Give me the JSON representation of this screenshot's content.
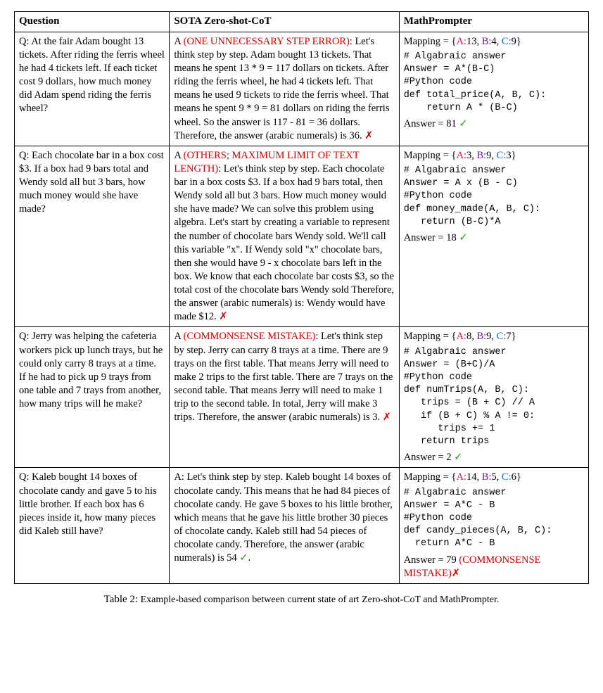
{
  "headers": {
    "q": "Question",
    "sota": "SOTA Zero-shot-CoT",
    "mp": "MathPrompter"
  },
  "caption": {
    "label": "Table 2:",
    "text": "Example-based comparison between current state of art Zero-shot-CoT and MathPrompter."
  },
  "rows": [
    {
      "question": "Q: At the fair Adam bought 13 tickets. After riding the ferris wheel he had 4 tickets left. If each ticket cost 9 dollars, how much money did Adam spend riding the ferris wheel?",
      "sota_prefix": "A ",
      "sota_err": "(ONE UNNECESSARY STEP ERROR)",
      "sota_body": ": Let's think step by step. Adam bought 13 tickets. That means he spent 13 * 9 = 117 dollars on tickets. After riding the ferris wheel, he had 4 tickets left. That means he used 9 tickets to ride the ferris wheel. That means he spent 9 * 9 = 81 dollars on riding the ferris wheel. So the answer is 117 - 81 = 36 dollars. Therefore, the answer (arabic numerals) is 36. ",
      "sota_mark": "✗",
      "sota_mark_color": "err",
      "mapping": {
        "label": "Mapping = {",
        "a": "A:13",
        "b": "B:4",
        "c": "C:9",
        "close": "}"
      },
      "code": "# Algabraic answer\nAnswer = A*(B-C)\n#Python code\ndef total_price(A, B, C):\n    return A * (B-C)",
      "ans_label": "Answer = ",
      "ans_value": "81 ",
      "ans_mark": "✓",
      "ans_mark_color": "ok",
      "ans_err": ""
    },
    {
      "question": "Q: Each chocolate bar in a box cost $3. If a box had 9 bars total and Wendy sold all but 3 bars, how much money would she have made?",
      "sota_prefix": "A ",
      "sota_err": "(OTHERS; MAXIMUM LIMIT OF TEXT LENGTH)",
      "sota_body": ": Let's think step by step. Each chocolate bar in a box costs $3. If a box had 9 bars total, then Wendy sold all but 3 bars. How much money would she have made? We can solve this problem using algebra. Let's start by creating a variable to represent the number of chocolate bars Wendy sold. We'll call this variable \"x\". If Wendy sold \"x\" chocolate bars, then she would have 9 - x chocolate bars left in the box. We know that each chocolate bar costs $3, so the total cost of the chocolate bars Wendy sold Therefore, the answer (arabic numerals) is: Wendy would have made $12. ",
      "sota_mark": "✗",
      "sota_mark_color": "err",
      "mapping": {
        "label": "Mapping = {",
        "a": "A:3",
        "b": "B:9",
        "c": "C:3",
        "close": "}"
      },
      "code": "# Algabraic answer\nAnswer = A x (B - C)\n#Python code\ndef money_made(A, B, C):\n   return (B-C)*A\n",
      "ans_label": "Answer = ",
      "ans_value": "18 ",
      "ans_mark": "✓",
      "ans_mark_color": "ok",
      "ans_err": ""
    },
    {
      "question": "Q: Jerry was helping the cafeteria workers pick up lunch trays, but he could only carry 8 trays at a time. If he had to pick up 9 trays from one table and 7 trays from another, how many trips will he make?",
      "sota_prefix": "A ",
      "sota_err": "(COMMONSENSE MISTAKE)",
      "sota_body": ": Let's think step by step. Jerry can carry 8 trays at a time. There are 9 trays on the first table. That means Jerry will need to make 2 trips to the first table. There are 7 trays on the second table. That means Jerry will need to make 1 trip to the second table. In total, Jerry will make 3 trips. Therefore, the answer (arabic numerals) is 3. ",
      "sota_mark": "✗",
      "sota_mark_color": "err",
      "mapping": {
        "label": "Mapping = {",
        "a": "A:8",
        "b": "B:9",
        "c": "C:7",
        "close": "}"
      },
      "code": "# Algabraic answer\nAnswer = (B+C)/A\n#Python code\ndef numTrips(A, B, C):\n   trips = (B + C) // A\n   if (B + C) % A != 0:\n      trips += 1\n   return trips",
      "ans_label": "Answer = ",
      "ans_value": "2 ",
      "ans_mark": "✓",
      "ans_mark_color": "ok",
      "ans_err": ""
    },
    {
      "question": "Q: Kaleb bought 14 boxes of chocolate candy and gave 5 to his little brother. If each box has 6 pieces inside it, how many pieces did Kaleb still have?",
      "sota_prefix": "A: ",
      "sota_err": "",
      "sota_body": "Let's think step by step. Kaleb bought 14 boxes of chocolate candy. This means that he had 84 pieces of chocolate candy. He gave 5 boxes to his little brother, which means that he gave his little brother 30 pieces of chocolate candy. Kaleb still had 54 pieces of chocolate candy. Therefore, the answer (arabic numerals) is 54 ",
      "sota_mark": "✓",
      "sota_mark_color": "ok",
      "sota_tail": ".",
      "mapping": {
        "label": "Mapping = {",
        "a": "A:14",
        "b": "B:5",
        "c": "C:6",
        "close": "}"
      },
      "code": "# Algabraic answer\nAnswer = A*C - B\n#Python code\ndef candy_pieces(A, B, C):\n  return A*C - B",
      "ans_label": "Answer = ",
      "ans_value": "79 ",
      "ans_err": "(COMMONSENSE MISTAKE)",
      "ans_mark": "✗",
      "ans_mark_color": "err"
    }
  ]
}
